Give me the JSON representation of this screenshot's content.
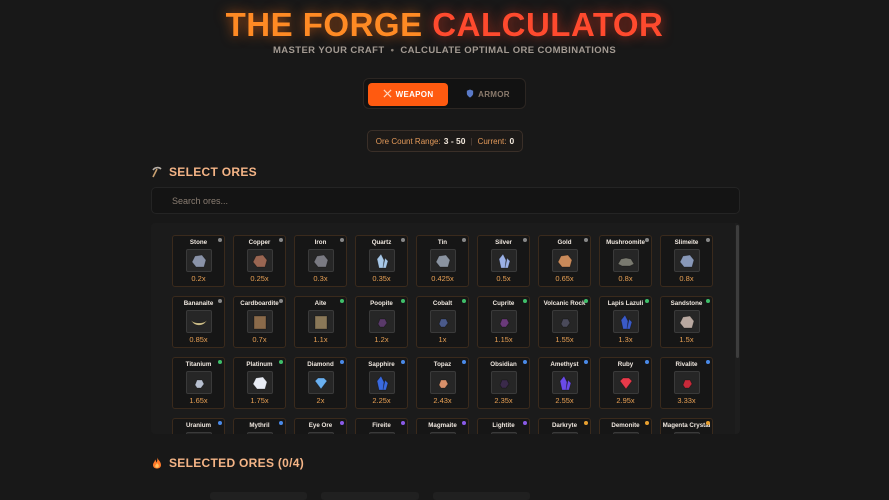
{
  "header": {
    "title_part1": "THE FORGE",
    "title_part2": "CALCULATOR",
    "subtitle_left": "MASTER YOUR CRAFT",
    "subtitle_sep": "•",
    "subtitle_right": "CALCULATE OPTIMAL ORE COMBINATIONS"
  },
  "mode": {
    "weapon_label": "WEAPON",
    "weapon_icon": "swords-icon",
    "armor_label": "ARMOR",
    "armor_icon": "shield-icon",
    "active": "weapon"
  },
  "range": {
    "label": "Ore Count Range:",
    "value": "3 - 50",
    "sep": "|",
    "current_label": "Current:",
    "current_value": "0"
  },
  "select_section": {
    "title": "SELECT ORES",
    "icon": "pickaxe-icon",
    "search_placeholder": "Search ores..."
  },
  "ores": [
    {
      "name": "Stone",
      "mult": "0.2x",
      "dot": "#888888",
      "rock": "#8a93a8",
      "shape": "rock"
    },
    {
      "name": "Copper",
      "mult": "0.25x",
      "dot": "#888888",
      "rock": "#9a6652",
      "shape": "rock"
    },
    {
      "name": "Iron",
      "mult": "0.3x",
      "dot": "#888888",
      "rock": "#7a7a82",
      "shape": "rock"
    },
    {
      "name": "Quartz",
      "mult": "0.35x",
      "dot": "#888888",
      "rock": "#a8c8e8",
      "shape": "crystal"
    },
    {
      "name": "Tin",
      "mult": "0.425x",
      "dot": "#888888",
      "rock": "#8a93a0",
      "shape": "rock"
    },
    {
      "name": "Silver",
      "mult": "0.5x",
      "dot": "#888888",
      "rock": "#9ab0e6",
      "shape": "crystal"
    },
    {
      "name": "Gold",
      "mult": "0.65x",
      "dot": "#888888",
      "rock": "#c98a5a",
      "shape": "rock"
    },
    {
      "name": "Mushroomite",
      "mult": "0.8x",
      "dot": "#888888",
      "rock": "#7a7a70",
      "shape": "flat"
    },
    {
      "name": "Slimeite",
      "mult": "0.8x",
      "dot": "#888888",
      "rock": "#8898b8",
      "shape": "rock"
    },
    {
      "name": "Bananaite",
      "mult": "0.85x",
      "dot": "#888888",
      "rock": "#d8c890",
      "shape": "banana"
    },
    {
      "name": "Cardboardite",
      "mult": "0.7x",
      "dot": "#888888",
      "rock": "#8a6a4a",
      "shape": "box"
    },
    {
      "name": "Aite",
      "mult": "1.1x",
      "dot": "#3fbf6a",
      "rock": "#8a7858",
      "shape": "box"
    },
    {
      "name": "Poopite",
      "mult": "1.2x",
      "dot": "#3fbf6a",
      "rock": "#5a3a6a",
      "shape": "small"
    },
    {
      "name": "Cobalt",
      "mult": "1x",
      "dot": "#3fbf6a",
      "rock": "#4a5a8a",
      "shape": "small"
    },
    {
      "name": "Cuprite",
      "mult": "1.15x",
      "dot": "#3fbf6a",
      "rock": "#6a3a7a",
      "shape": "small"
    },
    {
      "name": "Volcanic Rock",
      "mult": "1.55x",
      "dot": "#3fbf6a",
      "rock": "#4a4a5a",
      "shape": "small"
    },
    {
      "name": "Lapis Lazuli",
      "mult": "1.3x",
      "dot": "#3fbf6a",
      "rock": "#3a5ac8",
      "shape": "crystal"
    },
    {
      "name": "Sandstone",
      "mult": "1.5x",
      "dot": "#3fbf6a",
      "rock": "#b8a8a0",
      "shape": "rock"
    },
    {
      "name": "Titanium",
      "mult": "1.65x",
      "dot": "#3fbf6a",
      "rock": "#b8c0d0",
      "shape": "small"
    },
    {
      "name": "Platinum",
      "mult": "1.75x",
      "dot": "#3fbf6a",
      "rock": "#e8ecf4",
      "shape": "rock"
    },
    {
      "name": "Diamond",
      "mult": "2x",
      "dot": "#4a8ae8",
      "rock": "#6ab0f0",
      "shape": "gem"
    },
    {
      "name": "Sapphire",
      "mult": "2.25x",
      "dot": "#4a8ae8",
      "rock": "#3a6ae0",
      "shape": "crystal"
    },
    {
      "name": "Topaz",
      "mult": "2.43x",
      "dot": "#4a8ae8",
      "rock": "#d8906a",
      "shape": "small"
    },
    {
      "name": "Obsidian",
      "mult": "2.35x",
      "dot": "#4a8ae8",
      "rock": "#3a2a4a",
      "shape": "small"
    },
    {
      "name": "Amethyst",
      "mult": "2.55x",
      "dot": "#4a8ae8",
      "rock": "#6a4ae8",
      "shape": "crystal"
    },
    {
      "name": "Ruby",
      "mult": "2.95x",
      "dot": "#4a8ae8",
      "rock": "#e83a4a",
      "shape": "gem"
    },
    {
      "name": "Rivalite",
      "mult": "3.33x",
      "dot": "#4a8ae8",
      "rock": "#c82a3a",
      "shape": "small"
    },
    {
      "name": "Uranium",
      "mult": "",
      "dot": "#4a8ae8",
      "rock": "#4a8a4a",
      "shape": "small"
    },
    {
      "name": "Mythril",
      "mult": "",
      "dot": "#4a8ae8",
      "rock": "#6a8ad8",
      "shape": "small"
    },
    {
      "name": "Eye Ore",
      "mult": "",
      "dot": "#8a5ae8",
      "rock": "#8a3a3a",
      "shape": "small"
    },
    {
      "name": "Fireite",
      "mult": "",
      "dot": "#8a5ae8",
      "rock": "#e86a2a",
      "shape": "small"
    },
    {
      "name": "Magmaite",
      "mult": "",
      "dot": "#8a5ae8",
      "rock": "#c84a2a",
      "shape": "small"
    },
    {
      "name": "Lightite",
      "mult": "",
      "dot": "#8a5ae8",
      "rock": "#e8e0a0",
      "shape": "small"
    },
    {
      "name": "Darkryte",
      "mult": "",
      "dot": "#e8a030",
      "rock": "#3a2a4a",
      "shape": "small"
    },
    {
      "name": "Demonite",
      "mult": "",
      "dot": "#e8a030",
      "rock": "#8a2a2a",
      "shape": "small"
    },
    {
      "name": "Magenta Crystal",
      "mult": "",
      "dot": "#e8a030",
      "rock": "#d84ad8",
      "shape": "crystal"
    }
  ],
  "selected_section": {
    "title": "SELECTED ORES (0/4)",
    "icon": "flame-icon"
  },
  "colors": {
    "accent": "#ff5a10",
    "title_orange": "#ff8a24",
    "title_red": "#ff4a2e",
    "multiplier": "#e8a054"
  }
}
